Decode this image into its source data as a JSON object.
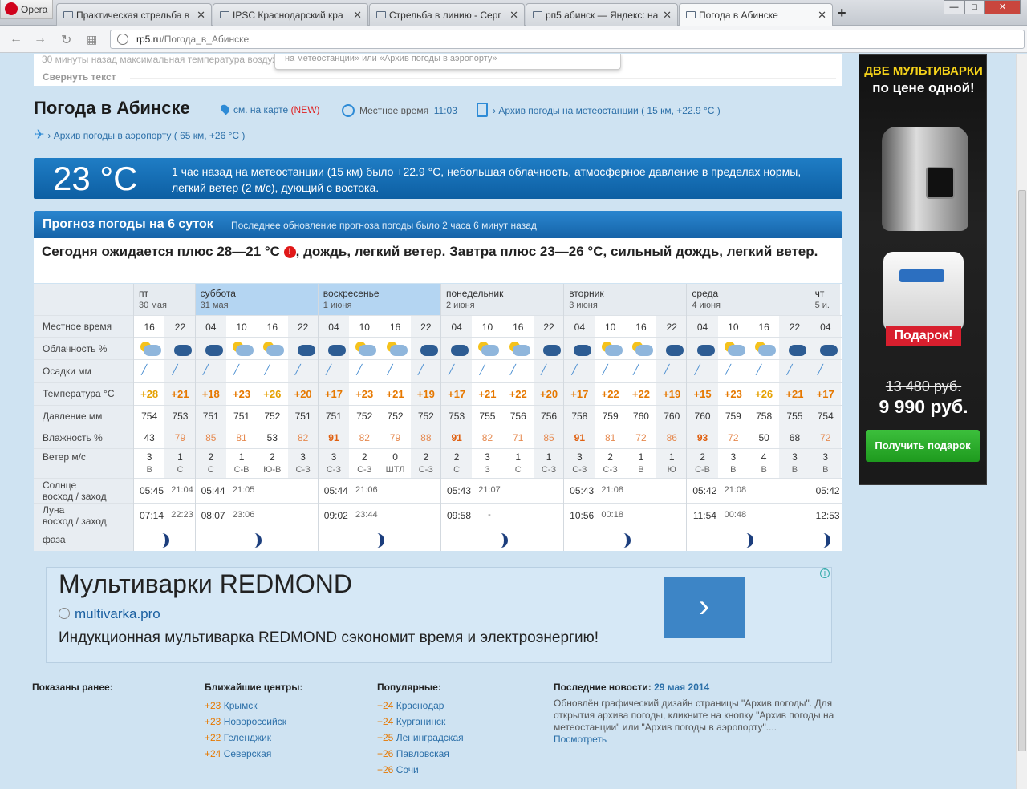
{
  "browser": {
    "opera_label": "Opera",
    "tabs": [
      {
        "label": "Практическая стрельба в"
      },
      {
        "label": "IPSC Краснодарский кра"
      },
      {
        "label": "Стрельба в линию - Серг"
      },
      {
        "label": "рп5 абинск — Яндекс: на"
      },
      {
        "label": "Погода в Абинске"
      }
    ],
    "new_tab": "+",
    "url_host": "rp5.ru",
    "url_path": "/Погода_в_Абинске"
  },
  "top": {
    "faded_text": "30 минуты назад максимальная температура воздуха",
    "popup_text": "на метеостанции» или «Архив погоды в аэропорту»",
    "collapse": "Свернуть текст"
  },
  "title": "Погода в Абинске",
  "meta": {
    "map": "см. на карте",
    "map_new": "(NEW)",
    "local_time_label": "Местное время",
    "local_time": "11:03",
    "archive_station": "› Архив погоды на метеостанции ( 15 км, +22.9 °C )",
    "archive_airport": "› Архив погоды в аэропорту ( 65 км, +26 °C )"
  },
  "current": {
    "temp": "23 °C",
    "desc": "1 час назад на метеостанции (15 км) было +22.9 °C, небольшая облачность, атмосферное давление в пределах нормы, легкий ветер (2 м/с), дующий с востока."
  },
  "forecast": {
    "title": "Прогноз погоды на 6 суток",
    "updated": "Последнее обновление прогноза погоды было 2 часа 6 минут назад",
    "summary_a": "Сегодня ожидается плюс 28—21 °C ",
    "summary_b": ", дождь, легкий ветер. Завтра плюс 23—26 °C, сильный дождь, легкий ветер.",
    "warn": "!",
    "row_labels": {
      "time": "Местное время",
      "clouds": "Облачность %",
      "precip": "Осадки мм",
      "temp": "Температура °C",
      "pressure": "Давление мм",
      "humidity": "Влажность %",
      "wind": "Ветер м/с",
      "sun_a": "Солнце",
      "sun_b": "восход / заход",
      "moon_a": "Луна",
      "moon_b": "восход / заход",
      "phase": "фаза"
    },
    "days": [
      {
        "name": "пт",
        "date": "30 мая",
        "sunrise": "05:45",
        "sunset": "21:04",
        "moonrise": "07:14",
        "moonset": "22:23"
      },
      {
        "name": "суббота",
        "date": "31 мая",
        "sunrise": "05:44",
        "sunset": "21:05",
        "moonrise": "08:07",
        "moonset": "23:06"
      },
      {
        "name": "воскресенье",
        "date": "1 июня",
        "sunrise": "05:44",
        "sunset": "21:06",
        "moonrise": "09:02",
        "moonset": "23:44"
      },
      {
        "name": "понедельник",
        "date": "2 июня",
        "sunrise": "05:43",
        "sunset": "21:07",
        "moonrise": "09:58",
        "moonset": "-"
      },
      {
        "name": "вторник",
        "date": "3 июня",
        "sunrise": "05:43",
        "sunset": "21:08",
        "moonrise": "10:56",
        "moonset": "00:18"
      },
      {
        "name": "среда",
        "date": "4 июня",
        "sunrise": "05:42",
        "sunset": "21:08",
        "moonrise": "11:54",
        "moonset": "00:48"
      },
      {
        "name": "чт",
        "date": "5 и.",
        "sunrise": "05:42",
        "sunset": "",
        "moonrise": "12:53",
        "moonset": ""
      }
    ],
    "hours": [
      "16",
      "22",
      "04",
      "10",
      "16",
      "22",
      "04",
      "10",
      "16",
      "22",
      "04",
      "10",
      "16",
      "22",
      "04",
      "10",
      "16",
      "22",
      "04",
      "10",
      "16",
      "22",
      "04"
    ],
    "temps": [
      "+28",
      "+21",
      "+18",
      "+23",
      "+26",
      "+20",
      "+17",
      "+23",
      "+21",
      "+19",
      "+17",
      "+21",
      "+22",
      "+20",
      "+17",
      "+22",
      "+22",
      "+19",
      "+15",
      "+23",
      "+26",
      "+21",
      "+17"
    ],
    "pressure": [
      "754",
      "753",
      "751",
      "751",
      "752",
      "751",
      "751",
      "752",
      "752",
      "752",
      "753",
      "755",
      "756",
      "756",
      "758",
      "759",
      "760",
      "760",
      "760",
      "759",
      "758",
      "755",
      "754"
    ],
    "humidity": [
      "43",
      "79",
      "85",
      "81",
      "53",
      "82",
      "91",
      "82",
      "79",
      "88",
      "91",
      "82",
      "71",
      "85",
      "91",
      "81",
      "72",
      "86",
      "93",
      "72",
      "50",
      "68",
      "72"
    ],
    "wind": [
      "3",
      "1",
      "2",
      "1",
      "2",
      "3",
      "3",
      "2",
      "0",
      "2",
      "2",
      "3",
      "1",
      "1",
      "3",
      "2",
      "1",
      "1",
      "2",
      "3",
      "4",
      "3",
      "3"
    ],
    "wind_dir": [
      "В",
      "С",
      "С",
      "С-В",
      "Ю-В",
      "С-З",
      "С-З",
      "С-З",
      "ШТЛ",
      "С-З",
      "С",
      "З",
      "С",
      "С-З",
      "С-З",
      "С-З",
      "В",
      "Ю",
      "С-В",
      "В",
      "В",
      "В",
      "В"
    ]
  },
  "ad": {
    "headline": "Мультиварки REDMOND",
    "domain": "multivarka.pro",
    "text": "Индукционная мультиварка REDMOND сэкономит время и электроэнергию!",
    "arrow": "›",
    "info": "i"
  },
  "footer": {
    "shown_title": "Показаны ранее:",
    "nearby_title": "Ближайшие центры:",
    "nearby": [
      {
        "t": "+23",
        "city": "Крымск"
      },
      {
        "t": "+23",
        "city": "Новороссийск"
      },
      {
        "t": "+22",
        "city": "Геленджик"
      },
      {
        "t": "+24",
        "city": "Северская"
      }
    ],
    "popular_title": "Популярные:",
    "popular": [
      {
        "t": "+24",
        "city": "Краснодар"
      },
      {
        "t": "+24",
        "city": "Курганинск"
      },
      {
        "t": "+25",
        "city": "Ленинградская"
      },
      {
        "t": "+26",
        "city": "Павловская"
      },
      {
        "t": "+26",
        "city": "Сочи"
      }
    ],
    "news_title": "Последние новости:",
    "news_date": "29 мая 2014",
    "news_text": "Обновлён графический дизайн страницы \"Архив погоды\". Для открытия архива погоды, кликните на кнопку \"Архив погоды на метеостанции\" или \"Архив погоды в аэропорту\"....",
    "news_link": "Посмотреть"
  },
  "side_ad": {
    "line1": "ДВЕ МУЛЬТИВАРКИ",
    "line2": "по цене одной!",
    "gift": "Подарок!",
    "old_price": "13 480 руб.",
    "new_price": "9 990 руб.",
    "button": "Получить подарок"
  }
}
